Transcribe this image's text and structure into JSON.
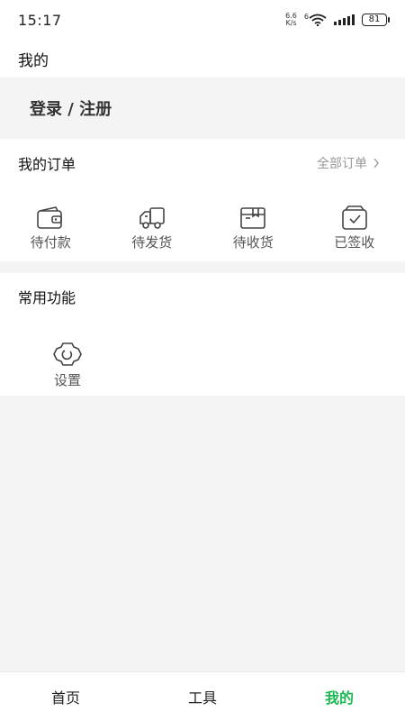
{
  "status_bar": {
    "time": "15:17",
    "net_speed_value": "6.6",
    "net_speed_unit": "K/s",
    "wifi_badge": "6",
    "battery": "81"
  },
  "header": {
    "title": "我的"
  },
  "login": {
    "label": "登录 / 注册"
  },
  "orders": {
    "title": "我的订单",
    "all_label": "全部订单",
    "items": [
      {
        "label": "待付款",
        "icon": "wallet-icon"
      },
      {
        "label": "待发货",
        "icon": "truck-icon"
      },
      {
        "label": "待收货",
        "icon": "package-icon"
      },
      {
        "label": "已签收",
        "icon": "signed-box-icon"
      }
    ]
  },
  "functions": {
    "title": "常用功能",
    "items": [
      {
        "label": "设置",
        "icon": "gear-icon"
      }
    ]
  },
  "tabbar": {
    "items": [
      {
        "label": "首页"
      },
      {
        "label": "工具"
      },
      {
        "label": "我的"
      }
    ],
    "active_color": "#1db954"
  }
}
